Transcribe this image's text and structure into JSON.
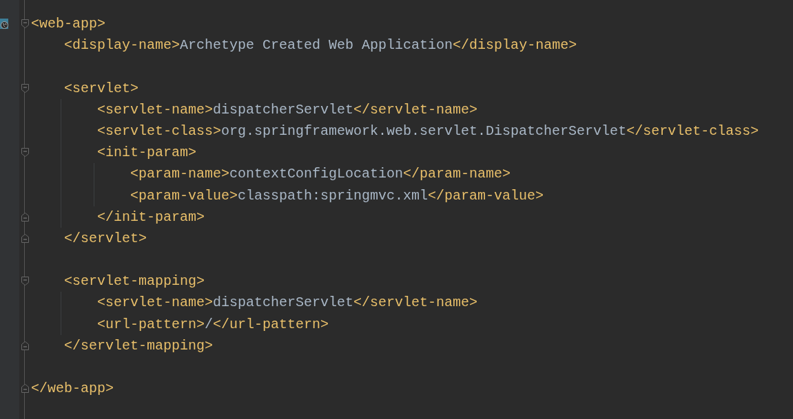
{
  "editor": {
    "tree": [
      {
        "kind": "element",
        "web_marker": true,
        "open": [
          {
            "kind": "tag",
            "text": "<web-app>"
          }
        ],
        "close": [
          {
            "kind": "tag",
            "text": "</web-app>"
          }
        ],
        "children": [
          {
            "kind": "line",
            "segments": [
              {
                "kind": "tag",
                "text": "<display-name>"
              },
              {
                "kind": "text",
                "text": "Archetype Created Web Application"
              },
              {
                "kind": "tag",
                "text": "</display-name>"
              }
            ]
          },
          {
            "kind": "blank"
          },
          {
            "kind": "element",
            "open": [
              {
                "kind": "tag",
                "text": "<servlet>"
              }
            ],
            "close": [
              {
                "kind": "tag",
                "text": "</servlet>"
              }
            ],
            "children": [
              {
                "kind": "line",
                "segments": [
                  {
                    "kind": "tag",
                    "text": "<servlet-name>"
                  },
                  {
                    "kind": "text",
                    "text": "dispatcherServlet"
                  },
                  {
                    "kind": "tag",
                    "text": "</servlet-name>"
                  }
                ]
              },
              {
                "kind": "line",
                "segments": [
                  {
                    "kind": "tag",
                    "text": "<servlet-class>"
                  },
                  {
                    "kind": "text",
                    "text": "org.springframework.web.servlet.DispatcherServlet"
                  },
                  {
                    "kind": "tag",
                    "text": "</servlet-class>"
                  }
                ]
              },
              {
                "kind": "element",
                "open": [
                  {
                    "kind": "tag",
                    "text": "<init-param>"
                  }
                ],
                "close": [
                  {
                    "kind": "tag",
                    "text": "</init-param>"
                  }
                ],
                "children": [
                  {
                    "kind": "line",
                    "segments": [
                      {
                        "kind": "tag",
                        "text": "<param-name>"
                      },
                      {
                        "kind": "text",
                        "text": "contextConfigLocation"
                      },
                      {
                        "kind": "tag",
                        "text": "</param-name>"
                      }
                    ]
                  },
                  {
                    "kind": "line",
                    "segments": [
                      {
                        "kind": "tag",
                        "text": "<param-value>"
                      },
                      {
                        "kind": "text",
                        "text": "classpath:springmvc.xml"
                      },
                      {
                        "kind": "tag",
                        "text": "</param-value>"
                      }
                    ]
                  }
                ]
              }
            ]
          },
          {
            "kind": "blank"
          },
          {
            "kind": "element",
            "open": [
              {
                "kind": "tag",
                "text": "<servlet-mapping>"
              }
            ],
            "close": [
              {
                "kind": "tag",
                "text": "</servlet-mapping>"
              }
            ],
            "children": [
              {
                "kind": "line",
                "segments": [
                  {
                    "kind": "tag",
                    "text": "<servlet-name>"
                  },
                  {
                    "kind": "text",
                    "text": "dispatcherServlet"
                  },
                  {
                    "kind": "tag",
                    "text": "</servlet-name>"
                  }
                ]
              },
              {
                "kind": "line",
                "segments": [
                  {
                    "kind": "tag",
                    "text": "<url-pattern>"
                  },
                  {
                    "kind": "text",
                    "text": "/"
                  },
                  {
                    "kind": "tag",
                    "text": "</url-pattern>"
                  }
                ]
              }
            ]
          },
          {
            "kind": "blank"
          }
        ]
      }
    ]
  }
}
